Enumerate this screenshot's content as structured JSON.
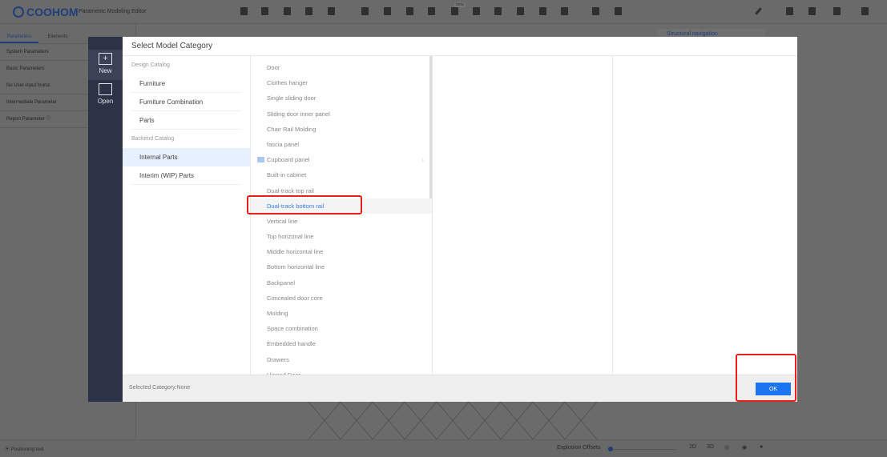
{
  "app": {
    "logo": "COOHOM",
    "title": "Parametric Modeling Editor",
    "beta": "beta"
  },
  "left_panel": {
    "tabs": [
      {
        "label": "Parameters",
        "active": true
      },
      {
        "label": "Elements"
      },
      {
        "label": ""
      }
    ],
    "items": [
      "System Parameters",
      "Basic Parameters",
      "No User-input found.",
      "Intermediate Parameter",
      "Report Parameter ⓘ"
    ]
  },
  "structural_nav": "Structural navigation",
  "dialog_sidebar": [
    {
      "label": "New",
      "icon": "new-folder-icon",
      "active": true
    },
    {
      "label": "Open",
      "icon": "folder-icon"
    }
  ],
  "dialog": {
    "title": "Select Model Category",
    "catalog": [
      {
        "group": "Design Catalog",
        "items": [
          {
            "label": "Furniture"
          },
          {
            "label": "Furniture Combination"
          },
          {
            "label": "Parts"
          }
        ]
      },
      {
        "group": "Backend Catalog",
        "items": [
          {
            "label": "Internal Parts",
            "selected": true
          },
          {
            "label": "Interim (WIP) Parts"
          }
        ]
      }
    ],
    "subcategories": [
      {
        "label": "Door"
      },
      {
        "label": "Clothes hanger"
      },
      {
        "label": "Single sliding door"
      },
      {
        "label": "Sliding door inner panel"
      },
      {
        "label": "Chair Rail Molding"
      },
      {
        "label": "fascia panel"
      },
      {
        "label": "Cupboard panel",
        "folder": true
      },
      {
        "label": "Built-in cabinet"
      },
      {
        "label": "Dual-track top rail"
      },
      {
        "label": "Dual-track bottom rail",
        "selected": true
      },
      {
        "label": "Vertical line"
      },
      {
        "label": "Top horizonal line"
      },
      {
        "label": "Middle horizontal line"
      },
      {
        "label": "Bottom horizontal line"
      },
      {
        "label": "Backpanel"
      },
      {
        "label": "Concealed door core"
      },
      {
        "label": "Molding"
      },
      {
        "label": "Space combination"
      },
      {
        "label": "Embedded handle"
      },
      {
        "label": "Drawers"
      },
      {
        "label": "Hinged Door"
      }
    ],
    "selected_category": "Selected Category:None",
    "ok_label": "OK"
  },
  "statusbar": {
    "positioning_tool": "⦿ Positioning tool",
    "explosion_offsets": "Explosion Offsets",
    "explosion_value": 0,
    "view_buttons": [
      "2D",
      "3D",
      "◎",
      "◉",
      "●"
    ]
  },
  "colors": {
    "accent": "#1b74f0",
    "highlight": "#ee1d1d",
    "dialog_sidebar": "#2d3347"
  }
}
